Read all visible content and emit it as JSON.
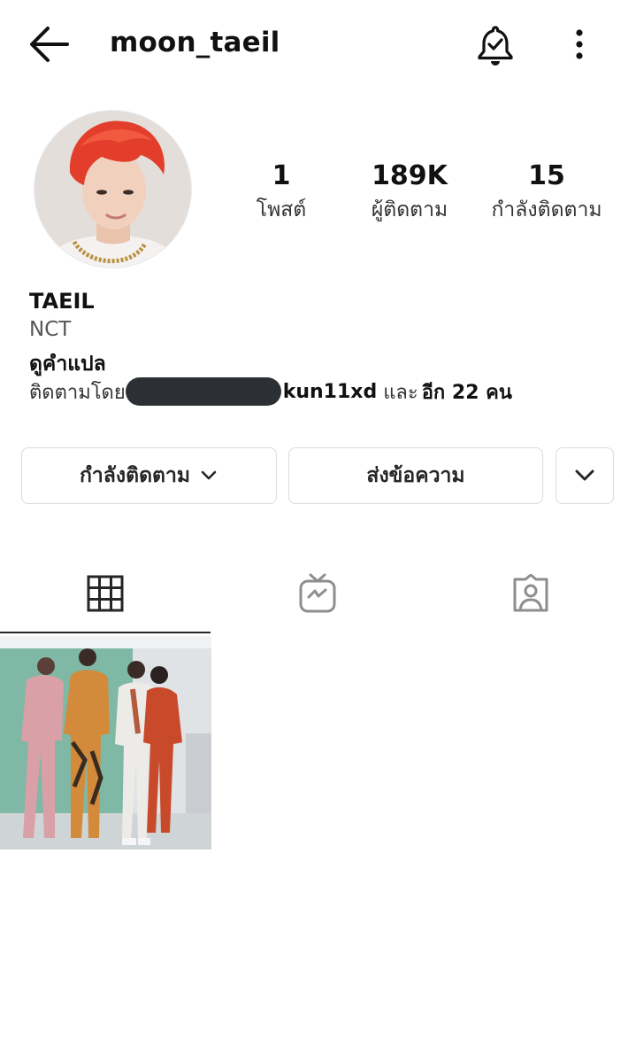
{
  "header": {
    "username": "moon_taeil",
    "back_icon": "arrow-left-icon",
    "notification_icon": "bell-check-icon",
    "more_icon": "kebab-menu-icon"
  },
  "stats": {
    "posts": {
      "value": "1",
      "label": "โพสต์"
    },
    "followers": {
      "value": "189K",
      "label": "ผู้ติดตาม"
    },
    "following": {
      "value": "15",
      "label": "กำลังติดตาม"
    }
  },
  "bio": {
    "name": "TAEIL",
    "category": "NCT",
    "translate_link": "ดูคำแปล",
    "followed_by_prefix": "ติดตามโดย",
    "followed_by_user": "kun11xd",
    "followed_by_suffix_1": " และ",
    "followed_by_suffix_2": "อีก 22 คน"
  },
  "actions": {
    "following_label": "กำลังติดตาม",
    "message_label": "ส่งข้อความ"
  },
  "tabs": [
    "grid-icon",
    "igtv-icon",
    "tagged-icon"
  ],
  "colors": {
    "text": "#262626",
    "border": "#dbdbdb",
    "redaction": "#2c3035"
  }
}
